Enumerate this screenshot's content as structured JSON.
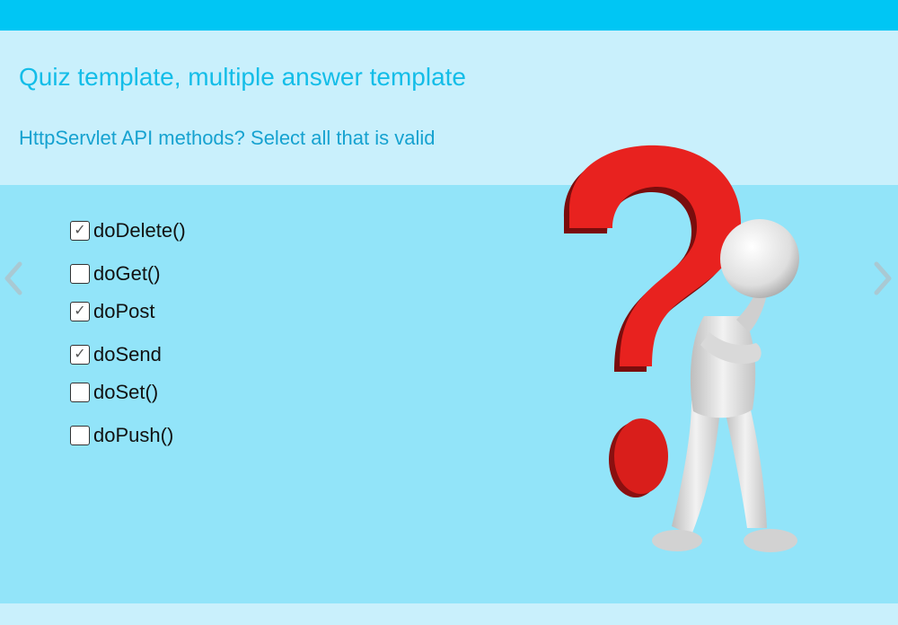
{
  "header": {
    "title": "Quiz template, multiple answer template",
    "question": "HttpServlet API methods? Select all that is valid"
  },
  "answers": [
    {
      "label": "doDelete()",
      "checked": true
    },
    {
      "label": "doGet()",
      "checked": false
    },
    {
      "label": "doPost",
      "checked": true
    },
    {
      "label": "doSend",
      "checked": true
    },
    {
      "label": "doSet()",
      "checked": false
    },
    {
      "label": "doPush()",
      "checked": false
    }
  ],
  "icons": {
    "check": "✓",
    "prev": "chevron-left-icon",
    "next": "chevron-right-icon",
    "illustration": "question-mark-figure-icon"
  },
  "colors": {
    "top_bar": "#00c6f4",
    "header_bg": "#c9f0fc",
    "main_bg": "#92e4f9",
    "title": "#13bde8",
    "question": "#16a2d0",
    "question_mark": "#e8221f",
    "nav_arrow": "#a9c9d3"
  }
}
